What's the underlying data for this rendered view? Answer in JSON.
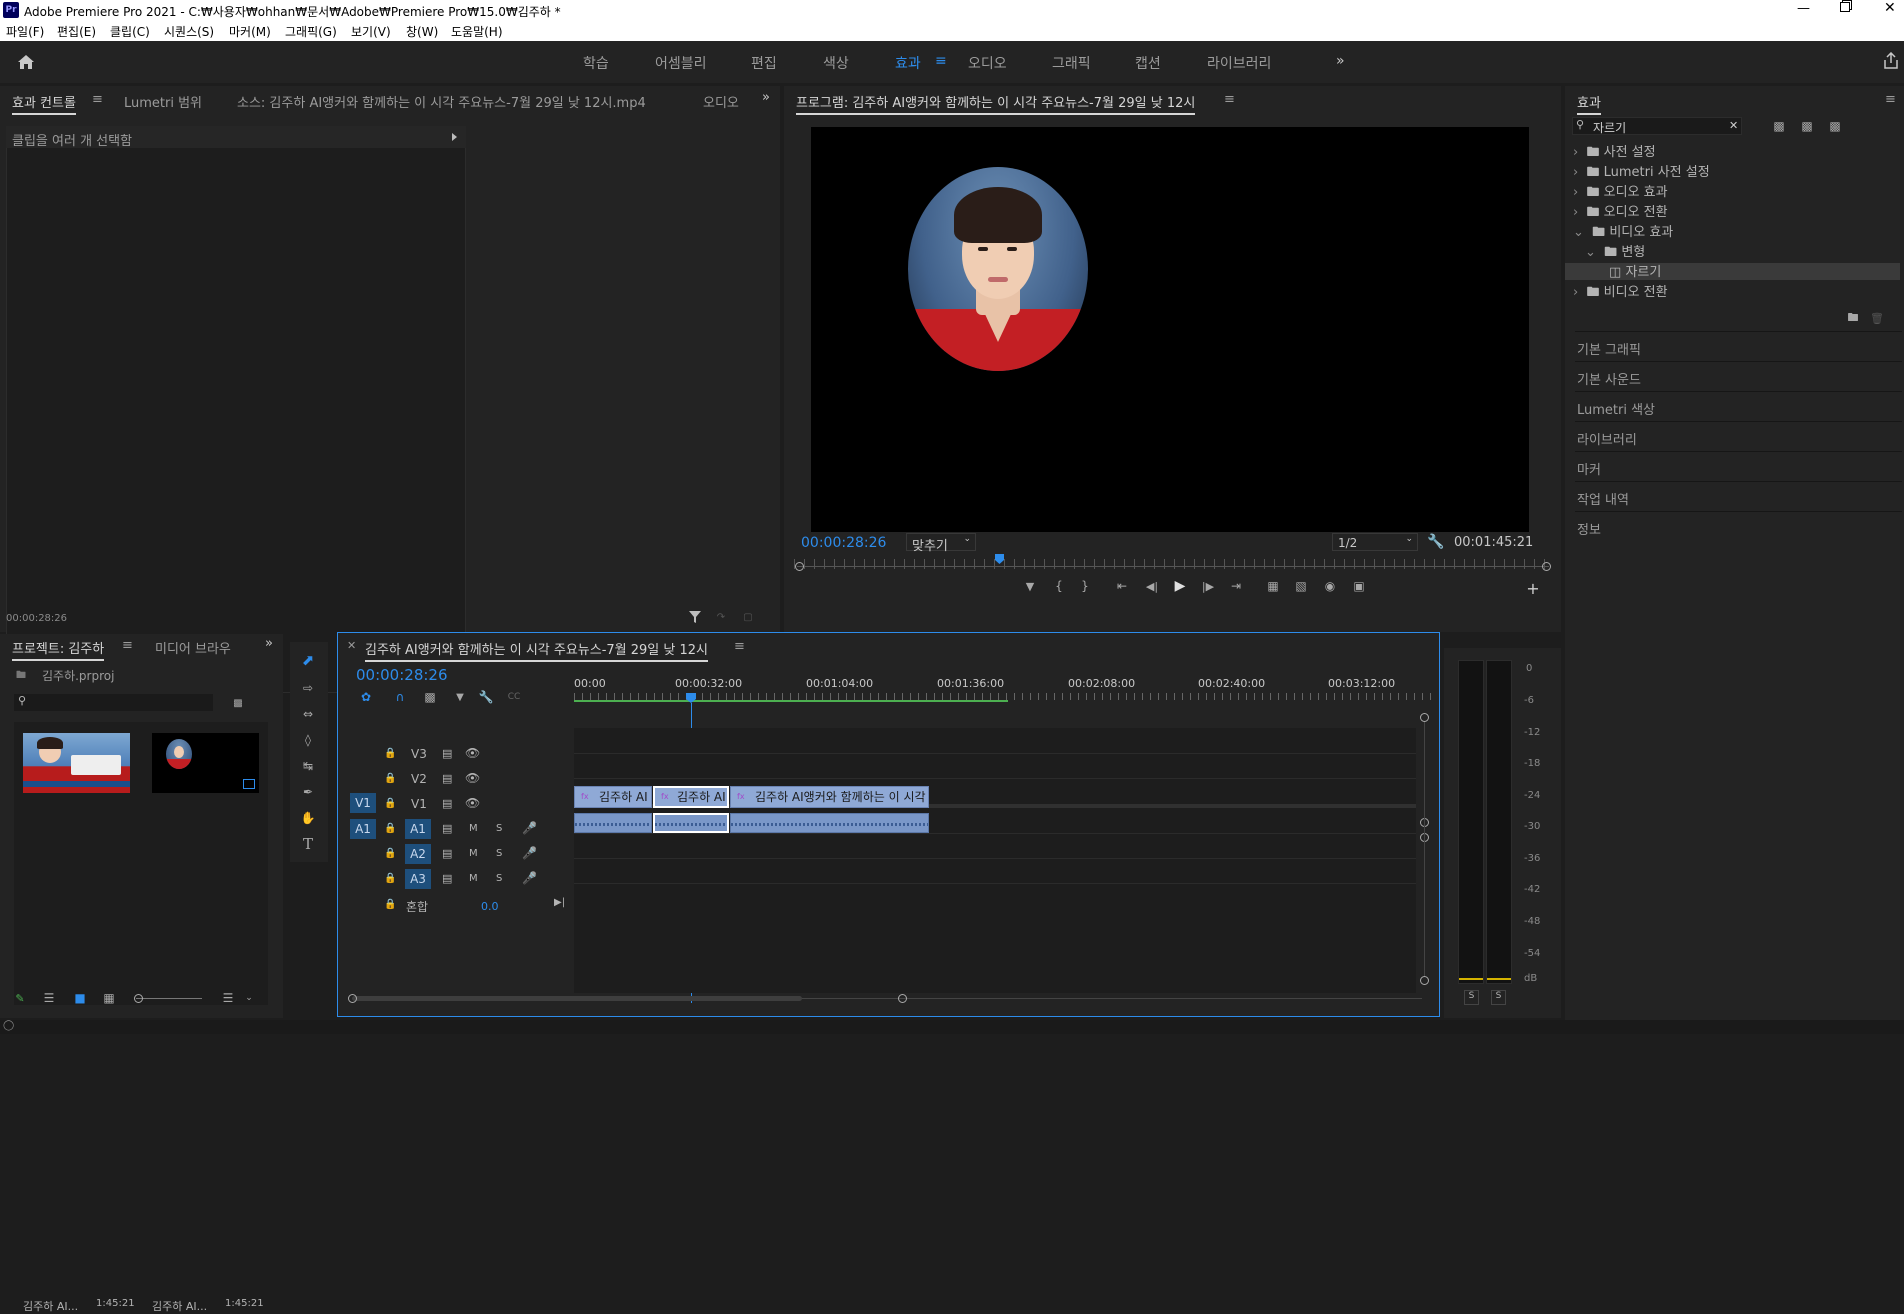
{
  "app": {
    "title": "Adobe Premiere Pro 2021 - C:₩사용자₩ohhan₩문서₩Adobe₩Premiere Pro₩15.0₩김주하 *",
    "logo": "Pr"
  },
  "menu": [
    "파일(F)",
    "편집(E)",
    "클립(C)",
    "시퀀스(S)",
    "마커(M)",
    "그래픽(G)",
    "보기(V)",
    "창(W)",
    "도움말(H)"
  ],
  "workspaces": [
    "학습",
    "어셈블리",
    "편집",
    "색상",
    "효과",
    "오디오",
    "그래픽",
    "캡션",
    "라이브러리"
  ],
  "workspace_active": "효과",
  "more": "»",
  "effect_controls": {
    "tabs": [
      "효과 컨트롤",
      "Lumetri 범위",
      "소스: 김주하 AI앵커와 함께하는 이 시각 주요뉴스-7월 29일 낮 12시.mp4",
      "오디오"
    ],
    "message": "클립을 여러 개 선택함",
    "timecode": "00:00:28:26"
  },
  "program": {
    "title": "프로그램: 김주하 AI앵커와 함께하는 이 시각 주요뉴스-7월 29일 낮 12시",
    "timecode": "00:00:28:26",
    "fit": "맞추기",
    "resolution": "1/2",
    "duration": "00:01:45:21"
  },
  "effects_panel": {
    "title": "효과",
    "search_value": "자르기",
    "tree": [
      {
        "label": "사전 설정",
        "level": 0
      },
      {
        "label": "Lumetri 사전 설정",
        "level": 0
      },
      {
        "label": "오디오 효과",
        "level": 0
      },
      {
        "label": "오디오 전환",
        "level": 0
      },
      {
        "label": "비디오 효과",
        "level": 0
      },
      {
        "label": "변형",
        "level": 1
      },
      {
        "label": "자르기",
        "level": 2
      },
      {
        "label": "비디오 전환",
        "level": 0
      }
    ],
    "sections": [
      "기본 그래픽",
      "기본 사운드",
      "Lumetri 색상",
      "라이브러리",
      "마커",
      "작업 내역",
      "정보"
    ]
  },
  "project": {
    "tabs": [
      "프로젝트: 김주하",
      "미디어 브라우"
    ],
    "file": "김주하.prproj",
    "items": [
      {
        "name": "김주하 AI...",
        "duration": "1:45:21"
      },
      {
        "name": "김주하 AI...",
        "duration": "1:45:21"
      }
    ]
  },
  "timeline": {
    "title": "김주하 AI앵커와 함께하는 이 시각 주요뉴스-7월 29일 낮 12시",
    "timecode": "00:00:28:26",
    "ruler": [
      "00:00",
      "00:00:32:00",
      "00:01:04:00",
      "00:01:36:00",
      "00:02:08:00",
      "00:02:40:00",
      "00:03:12:00"
    ],
    "video_tracks": [
      "V3",
      "V2",
      "V1"
    ],
    "audio_tracks": [
      "A1",
      "A2",
      "A3"
    ],
    "source_v": "V1",
    "source_a": "A1",
    "mix_label": "혼합",
    "mix_value": "0.0",
    "clips": [
      "김주하 AI",
      "김주하 AI",
      "김주하 AI앵커와 함께하는 이 시각"
    ],
    "m": "M",
    "s": "S"
  },
  "meter": {
    "scale": [
      "0",
      "-6",
      "-12",
      "-18",
      "-24",
      "-30",
      "-36",
      "-42",
      "-48",
      "-54",
      "dB"
    ],
    "solo": [
      "S",
      "S"
    ]
  }
}
